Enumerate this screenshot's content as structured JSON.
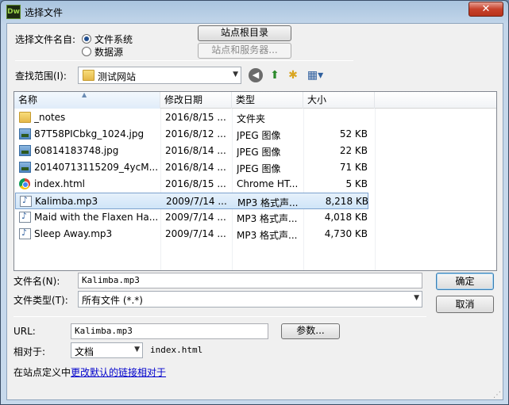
{
  "window": {
    "app_icon_text": "Dw",
    "title": "选择文件",
    "close_glyph": "✕"
  },
  "source": {
    "label": "选择文件名自:",
    "options": [
      "文件系统",
      "数据源"
    ],
    "selected": "文件系统",
    "site_root_button": "站点根目录",
    "site_server_button": "站点和服务器..."
  },
  "lookin": {
    "label": "查找范围(I):",
    "value": "测试网站",
    "toolbar_icons": [
      "back-icon",
      "up-folder-icon",
      "new-folder-icon",
      "view-menu-icon"
    ]
  },
  "file_list": {
    "columns": [
      "名称",
      "修改日期",
      "类型",
      "大小"
    ],
    "rows": [
      {
        "icon": "folder-icon",
        "name": "_notes",
        "date": "2016/8/15 ...",
        "type": "文件夹",
        "size": ""
      },
      {
        "icon": "image-file-icon",
        "name": "87T58PICbkg_1024.jpg",
        "date": "2016/8/12 ...",
        "type": "JPEG 图像",
        "size": "52 KB"
      },
      {
        "icon": "image-file-icon",
        "name": "60814183748.jpg",
        "date": "2016/8/14 ...",
        "type": "JPEG 图像",
        "size": "22 KB"
      },
      {
        "icon": "image-file-icon",
        "name": "20140713115209_4ycM...",
        "date": "2016/8/14 ...",
        "type": "JPEG 图像",
        "size": "71 KB"
      },
      {
        "icon": "chrome-file-icon",
        "name": "index.html",
        "date": "2016/8/15 ...",
        "type": "Chrome HT...",
        "size": "5 KB"
      },
      {
        "icon": "audio-file-icon",
        "name": "Kalimba.mp3",
        "date": "2009/7/14 ...",
        "type": "MP3 格式声...",
        "size": "8,218 KB"
      },
      {
        "icon": "audio-file-icon",
        "name": "Maid with the Flaxen Ha...",
        "date": "2009/7/14 ...",
        "type": "MP3 格式声...",
        "size": "4,018 KB"
      },
      {
        "icon": "audio-file-icon",
        "name": "Sleep Away.mp3",
        "date": "2009/7/14 ...",
        "type": "MP3 格式声...",
        "size": "4,730 KB"
      }
    ],
    "selected_row": "Kalimba.mp3"
  },
  "filename": {
    "label": "文件名(N):",
    "value": "Kalimba.mp3",
    "ok_button": "确定"
  },
  "filetype": {
    "label": "文件类型(T):",
    "value": "所有文件 (*.*)",
    "cancel_button": "取消"
  },
  "url": {
    "label": "URL:",
    "value": "Kalimba.mp3",
    "params_button": "参数..."
  },
  "relative": {
    "label": "相对于:",
    "value": "文档",
    "file": "index.html"
  },
  "footer": {
    "prefix": "在站点定义中",
    "link": "更改默认的链接相对于"
  }
}
